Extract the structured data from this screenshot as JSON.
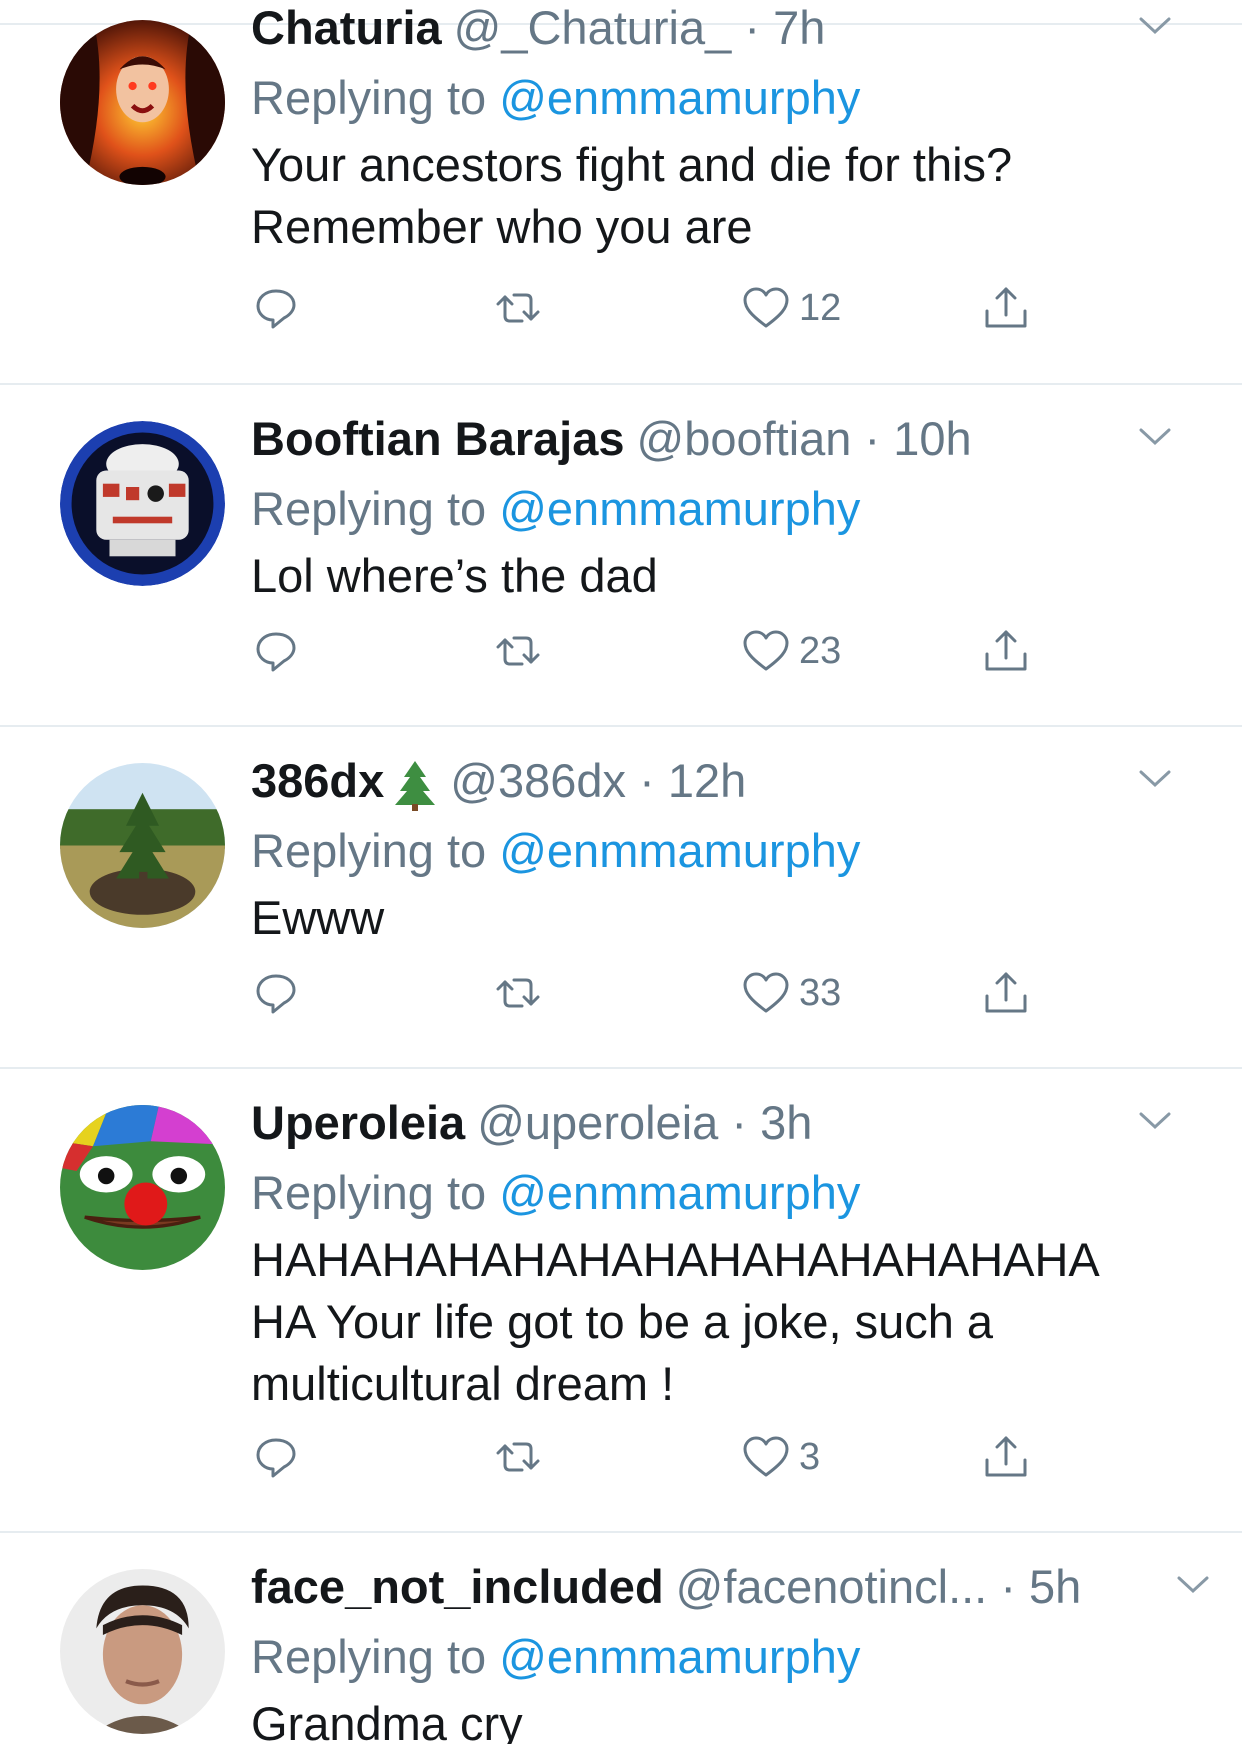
{
  "tweets": [
    {
      "name": "Chaturia",
      "handle": "@_Chaturia_",
      "time": "7h",
      "replying_label": "Replying to",
      "replying_to": "@enmmamurphy",
      "text": "Your ancestors fight and die for this? Remember who you are",
      "likes": "12",
      "avatar_icon": "dark-fantasy-avatar"
    },
    {
      "name": "Booftian Barajas",
      "handle": "@booftian",
      "time": "10h",
      "replying_label": "Replying to",
      "replying_to": "@enmmamurphy",
      "text": "Lol where’s the dad",
      "likes": "23",
      "avatar_icon": "lego-robot-avatar"
    },
    {
      "name": "386dx",
      "emoji": "evergreen-tree-emoji",
      "handle": "@386dx",
      "time": "12h",
      "replying_label": "Replying to",
      "replying_to": "@enmmamurphy",
      "text": "Ewww",
      "likes": "33",
      "avatar_icon": "pine-tree-avatar"
    },
    {
      "name": "Uperoleia",
      "handle": "@uperoleia",
      "time": "3h",
      "replying_label": "Replying to",
      "replying_to": "@enmmamurphy",
      "text_lines": [
        "HAHAHAHAHAHAHAHAHAHAHAHAHA",
        "HA Your life got to be a joke, such a",
        "multicultural dream !"
      ],
      "likes": "3",
      "avatar_icon": "clown-frog-avatar"
    },
    {
      "name": "face_not_included",
      "handle": "@facenotincl...",
      "time": "5h",
      "replying_label": "Replying to",
      "replying_to": "@enmmamurphy",
      "text": "Grandma cry",
      "avatar_icon": "face-photo-avatar"
    }
  ],
  "separator": "·",
  "colors": {
    "text": "#14171a",
    "secondary": "#657786",
    "link": "#1b95e0",
    "divider": "#e6ecf0"
  }
}
